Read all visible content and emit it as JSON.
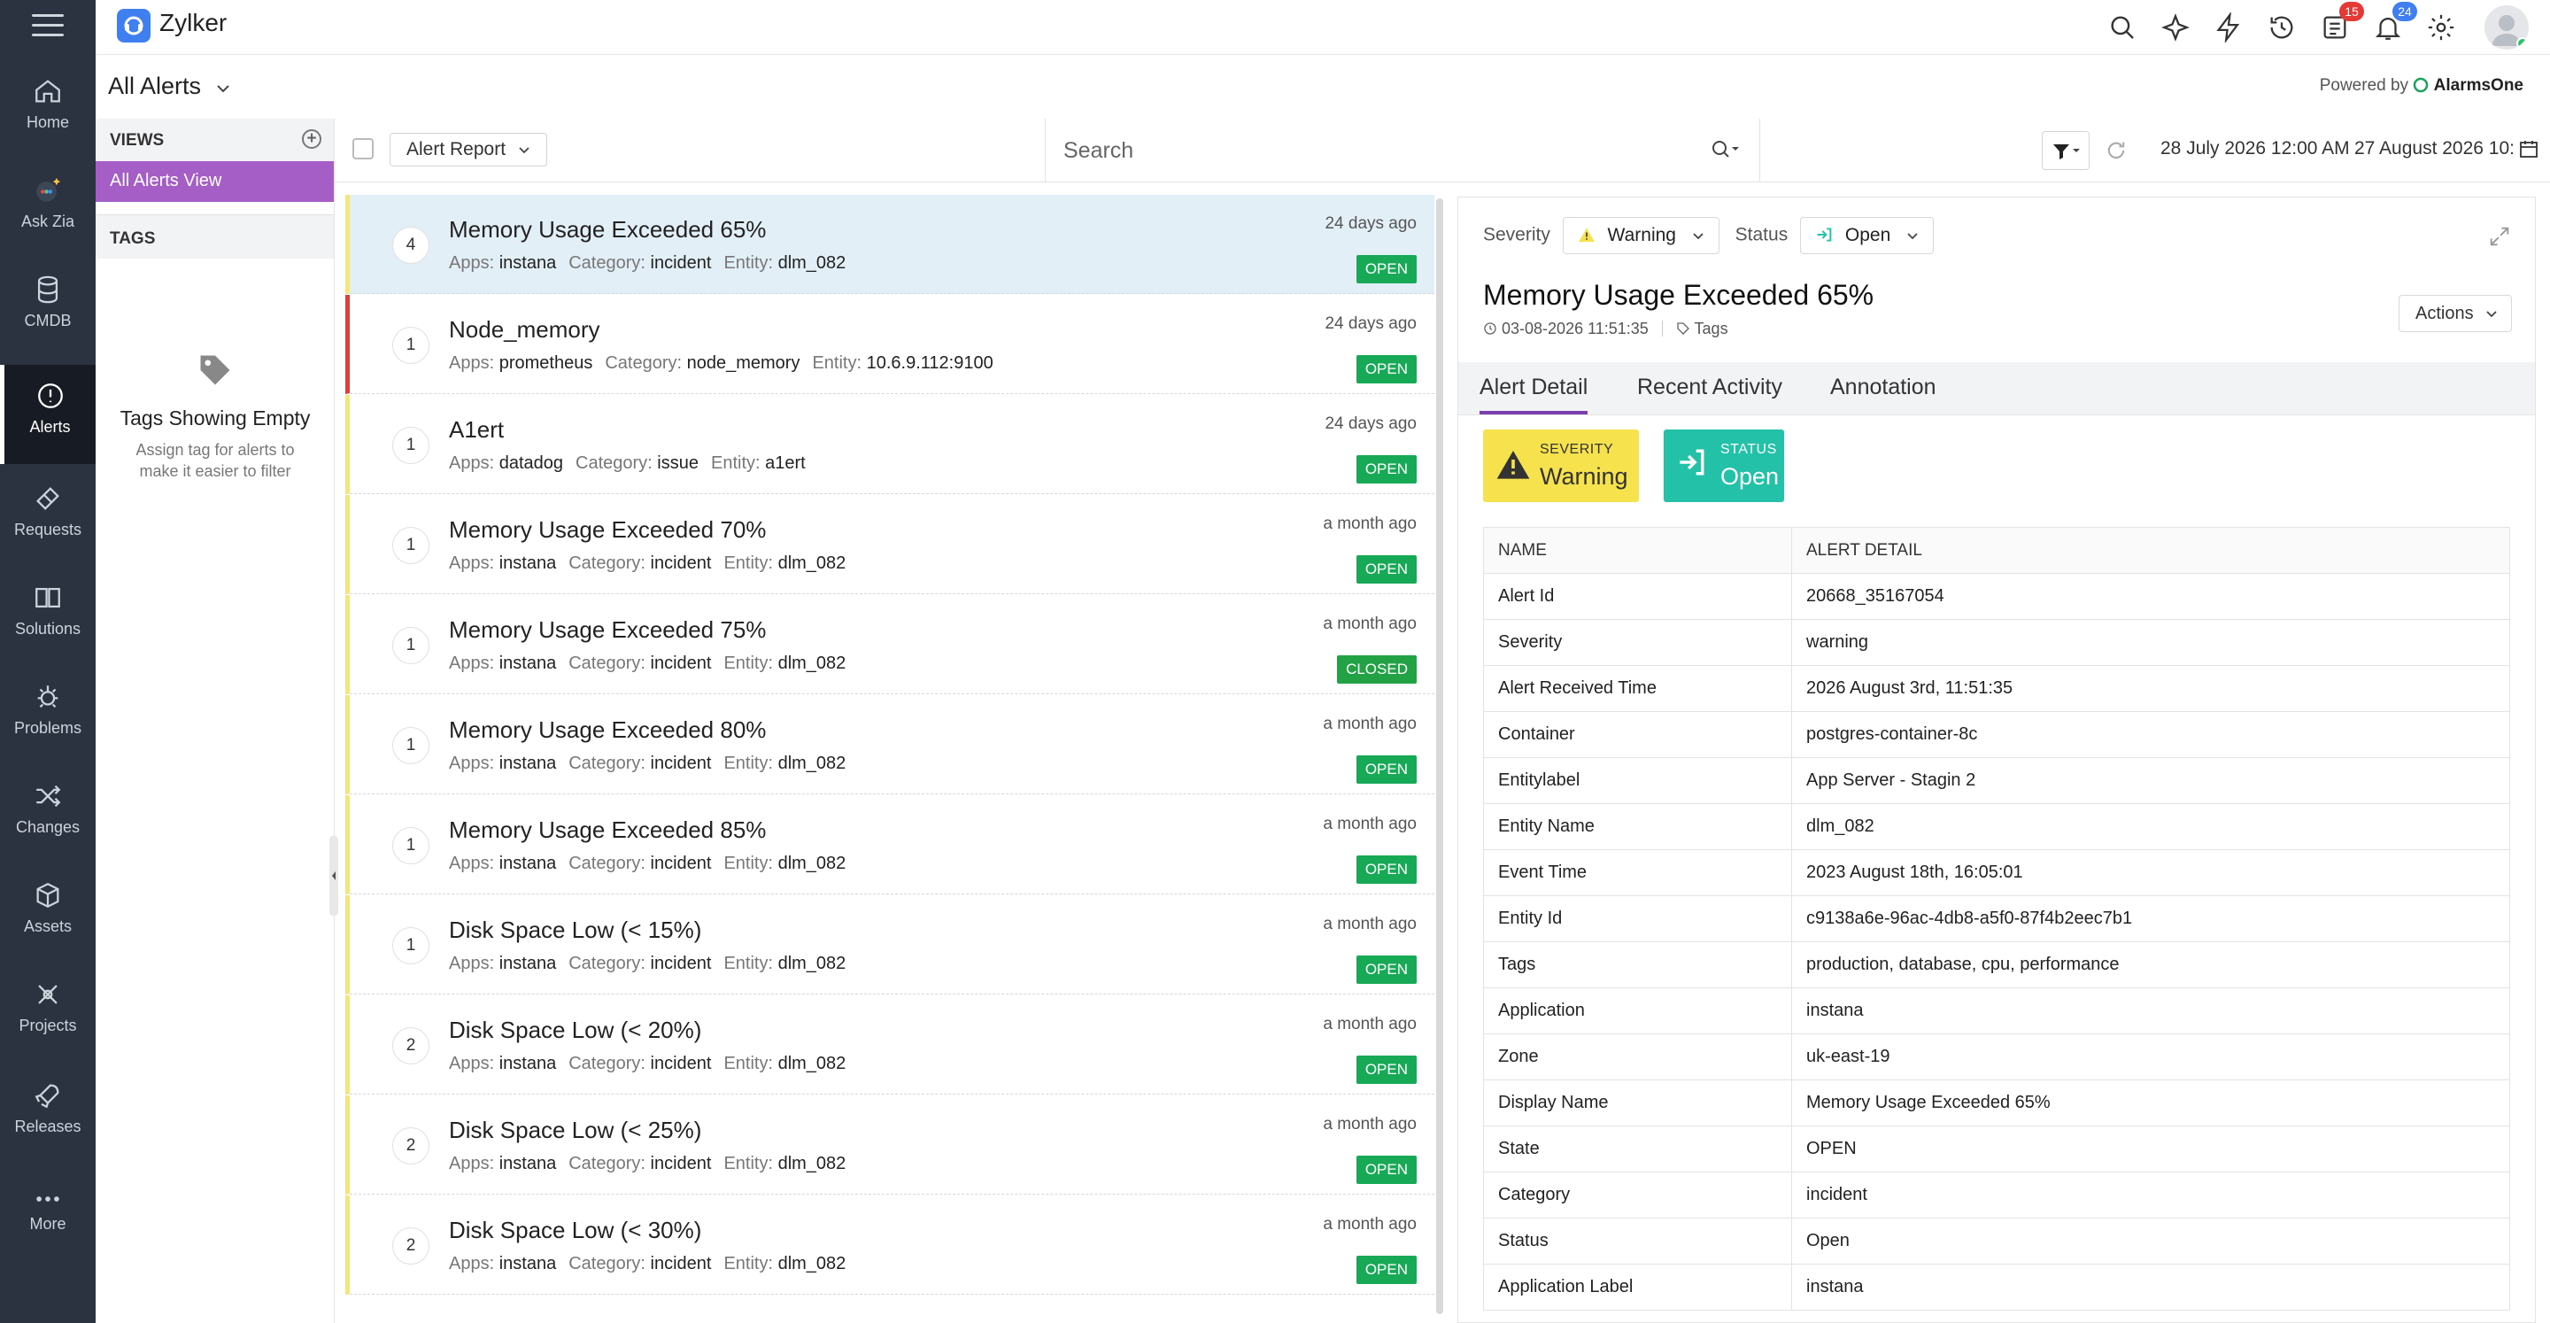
{
  "app": {
    "name": "Zylker",
    "powered_by": "Powered by",
    "powered_brand": "AlarmsOne"
  },
  "badges": {
    "tasks": "15",
    "notifications": "24"
  },
  "nav": [
    {
      "label": "Home",
      "icon": "home-icon"
    },
    {
      "label": "Ask Zia",
      "icon": "zia-icon"
    },
    {
      "label": "CMDB",
      "icon": "database-icon"
    },
    {
      "label": "Alerts",
      "icon": "alert-icon",
      "active": true
    },
    {
      "label": "Requests",
      "icon": "ticket-icon"
    },
    {
      "label": "Solutions",
      "icon": "book-icon"
    },
    {
      "label": "Problems",
      "icon": "bug-icon"
    },
    {
      "label": "Changes",
      "icon": "shuffle-icon"
    },
    {
      "label": "Assets",
      "icon": "cube-icon"
    },
    {
      "label": "Projects",
      "icon": "projects-icon"
    },
    {
      "label": "Releases",
      "icon": "rocket-icon"
    },
    {
      "label": "More",
      "icon": "more-dots-icon"
    }
  ],
  "page": {
    "title": "All Alerts"
  },
  "views": {
    "header": "VIEWS",
    "selected": "All Alerts View",
    "tags_header": "TAGS",
    "empty_title": "Tags Showing Empty",
    "empty_text_1": "Assign tag for alerts to",
    "empty_text_2": "make it easier to filter"
  },
  "toolbar": {
    "report": "Alert Report",
    "search_placeholder": "Search",
    "date_from": "28 July 2026 12:00 AM",
    "date_to": "27 August 2026 10:"
  },
  "labels": {
    "apps": "Apps:",
    "category": "Category:",
    "entity": "Entity:"
  },
  "alerts": [
    {
      "count": "4",
      "title": "Memory Usage Exceeded 65%",
      "apps": "instana",
      "category": "incident",
      "entity": "dlm_082",
      "time": "24 days ago",
      "status": "OPEN"
    },
    {
      "count": "1",
      "title": "Node_memory",
      "apps": "prometheus",
      "category": "node_memory",
      "entity": "10.6.9.112:9100",
      "time": "24 days ago",
      "status": "OPEN"
    },
    {
      "count": "1",
      "title": "A1ert",
      "apps": "datadog",
      "category": "issue",
      "entity": "a1ert",
      "time": "24 days ago",
      "status": "OPEN"
    },
    {
      "count": "1",
      "title": "Memory Usage Exceeded 70%",
      "apps": "instana",
      "category": "incident",
      "entity": "dlm_082",
      "time": "a month ago",
      "status": "OPEN"
    },
    {
      "count": "1",
      "title": "Memory Usage Exceeded 75%",
      "apps": "instana",
      "category": "incident",
      "entity": "dlm_082",
      "time": "a month ago",
      "status": "CLOSED"
    },
    {
      "count": "1",
      "title": "Memory Usage Exceeded 80%",
      "apps": "instana",
      "category": "incident",
      "entity": "dlm_082",
      "time": "a month ago",
      "status": "OPEN"
    },
    {
      "count": "1",
      "title": "Memory Usage Exceeded 85%",
      "apps": "instana",
      "category": "incident",
      "entity": "dlm_082",
      "time": "a month ago",
      "status": "OPEN"
    },
    {
      "count": "1",
      "title": "Disk Space Low (< 15%)",
      "apps": "instana",
      "category": "incident",
      "entity": "dlm_082",
      "time": "a month ago",
      "status": "OPEN"
    },
    {
      "count": "2",
      "title": "Disk Space Low (< 20%)",
      "apps": "instana",
      "category": "incident",
      "entity": "dlm_082",
      "time": "a month ago",
      "status": "OPEN"
    },
    {
      "count": "2",
      "title": "Disk Space Low (< 25%)",
      "apps": "instana",
      "category": "incident",
      "entity": "dlm_082",
      "time": "a month ago",
      "status": "OPEN"
    },
    {
      "count": "2",
      "title": "Disk Space Low (< 30%)",
      "apps": "instana",
      "category": "incident",
      "entity": "dlm_082",
      "time": "a month ago",
      "status": "OPEN"
    }
  ],
  "detail": {
    "severity_label": "Severity",
    "severity_value": "Warning",
    "status_label": "Status",
    "status_value": "Open",
    "title": "Memory Usage Exceeded 65%",
    "timestamp": "03-08-2026 11:51:35",
    "tags_link": "Tags",
    "actions": "Actions",
    "tabs": [
      "Alert Detail",
      "Recent Activity",
      "Annotation"
    ],
    "card_severity_label": "SEVERITY",
    "card_severity_value": "Warning",
    "card_status_label": "STATUS",
    "card_status_value": "Open",
    "table_headers": [
      "NAME",
      "ALERT DETAIL"
    ],
    "rows": [
      [
        "Alert Id",
        "20668_35167054"
      ],
      [
        "Severity",
        "warning"
      ],
      [
        "Alert Received Time",
        "2026 August 3rd, 11:51:35"
      ],
      [
        "Container",
        "postgres-container-8c"
      ],
      [
        "Entitylabel",
        "App Server - Stagin 2"
      ],
      [
        "Entity Name",
        "dlm_082"
      ],
      [
        "Event Time",
        "2023 August 18th, 16:05:01"
      ],
      [
        "Entity Id",
        "c9138a6e-96ac-4db8-a5f0-87f4b2eec7b1"
      ],
      [
        "Tags",
        "production, database, cpu, performance"
      ],
      [
        "Application",
        "instana"
      ],
      [
        "Zone",
        "uk-east-19"
      ],
      [
        "Display Name",
        "Memory Usage Exceeded 65%"
      ],
      [
        "State",
        "OPEN"
      ],
      [
        "Category",
        "incident"
      ],
      [
        "Status",
        "Open"
      ],
      [
        "Application Label",
        "instana"
      ]
    ]
  },
  "colors": {
    "nav_bg": "#2b3340",
    "view_selected": "#a55ec6",
    "open_badge": "#18a957",
    "warning_card": "#f5e24c",
    "status_card": "#22c1a8",
    "tab_accent": "#7c3fb0"
  }
}
